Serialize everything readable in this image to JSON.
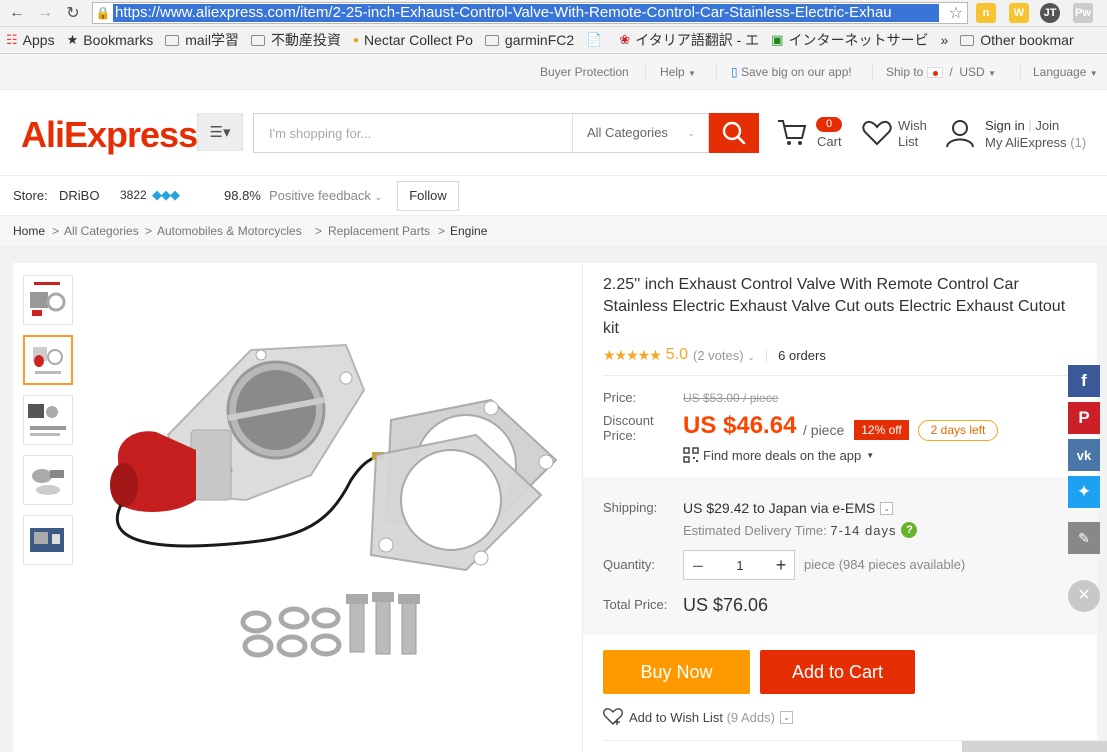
{
  "browser": {
    "url": "https://www.aliexpress.com/item/2-25-inch-Exhaust-Control-Valve-With-Remote-Control-Car-Stainless-Electric-Exhau",
    "bookmarks": [
      "Apps",
      "Bookmarks",
      "mail学習",
      "不動産投資",
      "Nectar Collect Po",
      "garminFC2",
      "",
      "イタリア語翻訳 - エ",
      "インターネットサービ",
      "»",
      "Other bookmar"
    ]
  },
  "topbar": {
    "buyer_protection": "Buyer Protection",
    "help": "Help",
    "app_promo": "Save big on our app!",
    "ship_to": "Ship to",
    "currency": "USD",
    "language": "Language"
  },
  "header": {
    "logo": "AliExpress",
    "search_placeholder": "I'm shopping for...",
    "category": "All Categories",
    "cart_count": "0",
    "cart_label": "Cart",
    "wish_line1": "Wish",
    "wish_line2": "List",
    "sign_in": "Sign in",
    "join": "Join",
    "my_ali": "My AliExpress",
    "my_ali_count": "(1)"
  },
  "store": {
    "label": "Store:",
    "name": "DRiBO",
    "score": "3822",
    "feedback_pct": "98.8%",
    "feedback_label": "Positive feedback",
    "follow": "Follow"
  },
  "breadcrumb": [
    "Home",
    "All Categories",
    "Automobiles & Motorcycles",
    "Replacement Parts",
    "Engine"
  ],
  "product": {
    "title": "2.25'' inch Exhaust Control Valve With Remote Control Car Stainless Electric Exhaust Valve Cut outs Electric Exhaust Cutout kit",
    "stars": "★★★★★",
    "rating": "5.0",
    "votes": "(2 votes)",
    "orders": "6 orders",
    "price_label": "Price:",
    "old_price": "US $53.00 / piece",
    "discount_label_1": "Discount",
    "discount_label_2": "Price:",
    "discount_price": "US $46.64",
    "per_piece": "/ piece",
    "off_badge": "12% off",
    "days_left": "2 days left",
    "app_deals": "Find more deals on the app",
    "shipping_label": "Shipping:",
    "shipping_value": "US $29.42 to Japan via e-EMS",
    "est_label": "Estimated Delivery Time:",
    "est_value": "7-14 days",
    "quantity_label": "Quantity:",
    "quantity": "1",
    "qty_info": "piece (984 pieces available)",
    "total_label": "Total Price:",
    "total_value": "US $76.06",
    "buy_now": "Buy Now",
    "add_to_cart": "Add to Cart",
    "wish_add": "Add to Wish List",
    "wish_adds": "(9 Adds)"
  },
  "colors": {
    "brand": "#e62e04",
    "orange": "#ff9900",
    "star": "#f5a623",
    "facebook": "#3b5998",
    "pinterest": "#cb2027",
    "vk": "#4a76a8",
    "twitter": "#1da1f2"
  },
  "icons": [
    "search-icon",
    "cart-icon",
    "heart-icon",
    "user-icon",
    "facebook-icon",
    "pinterest-icon",
    "vk-icon",
    "twitter-icon",
    "pencil-icon",
    "close-icon"
  ]
}
